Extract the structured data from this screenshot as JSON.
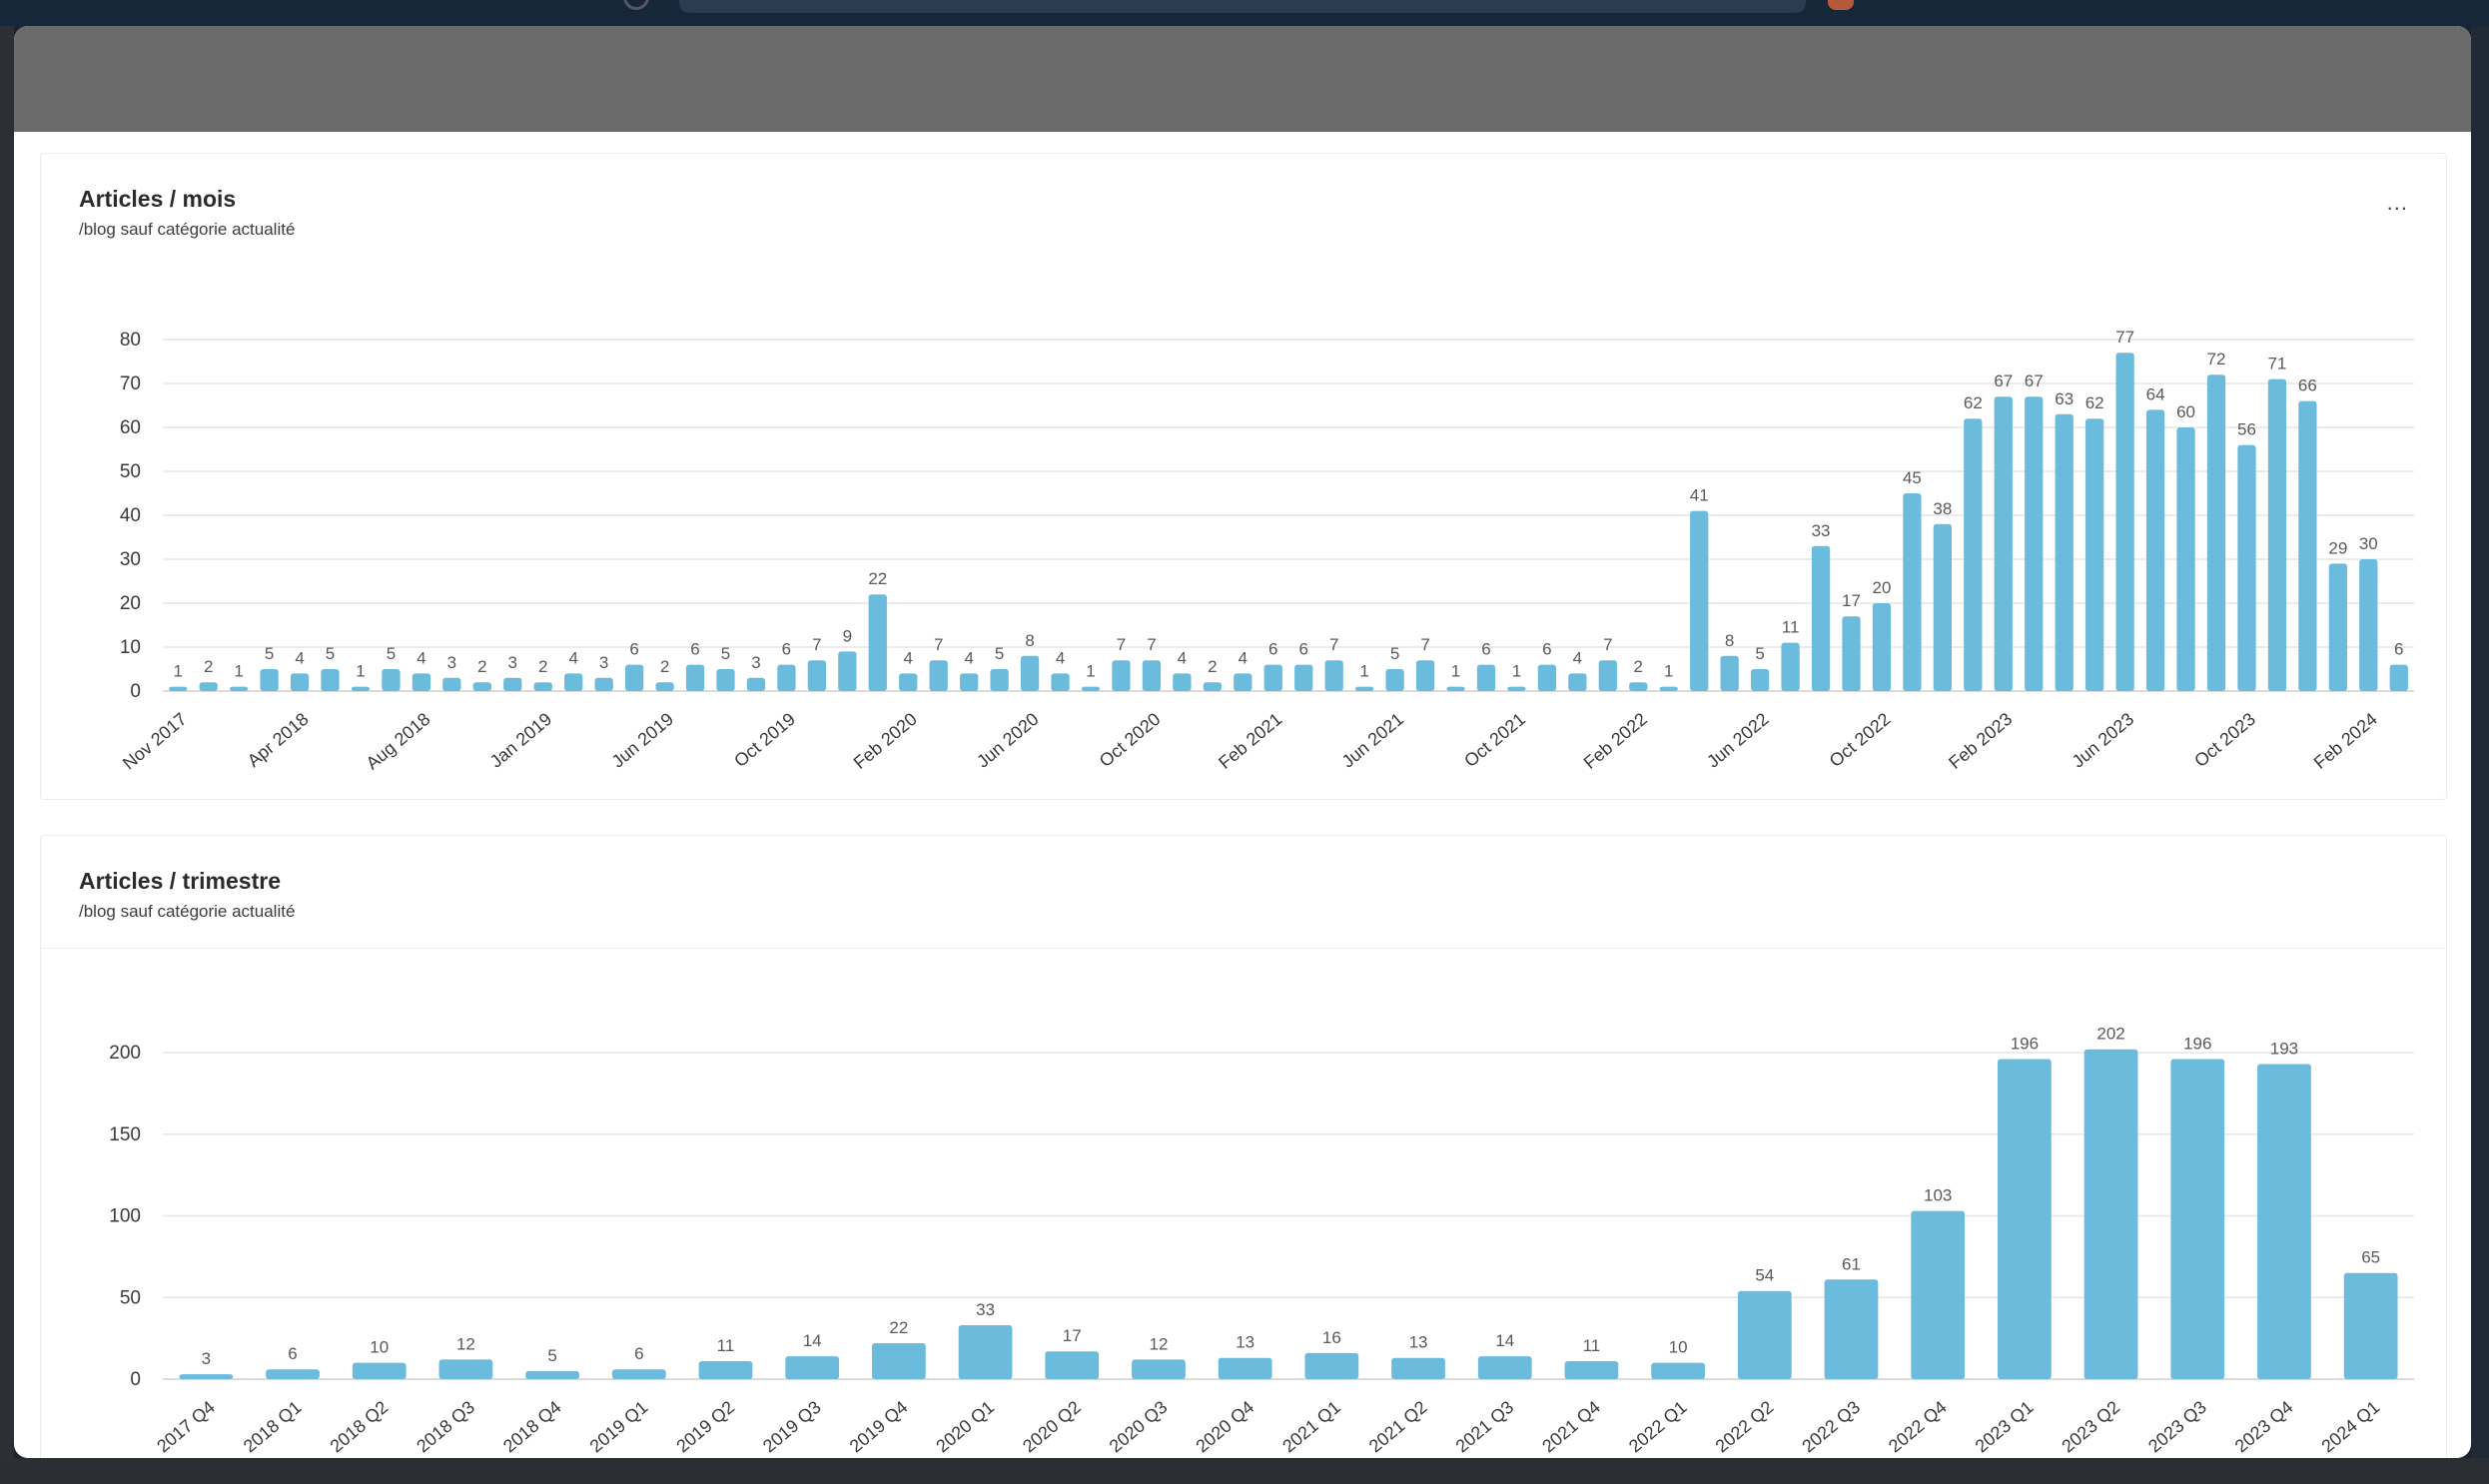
{
  "colors": {
    "bar": "#6bbbdc",
    "modal_header": "#6b6b6b",
    "title": "#2b2b2b"
  },
  "cards": [
    {
      "title": "Articles / mois",
      "subtitle": "/blog sauf catégorie actualité",
      "more_label": "...",
      "more_icon": "ellipsis-icon"
    },
    {
      "title": "Articles / trimestre",
      "subtitle": "/blog sauf catégorie actualité"
    }
  ],
  "chart_data": [
    {
      "type": "bar",
      "title": "Articles / mois",
      "subtitle": "/blog sauf catégorie actualité",
      "ylim": [
        0,
        80
      ],
      "yticks": [
        0,
        10,
        20,
        30,
        40,
        50,
        60,
        70,
        80
      ],
      "grid": true,
      "x_tick_labels": [
        {
          "index": 0,
          "label": "Nov 2017"
        },
        {
          "index": 4,
          "label": "Apr 2018"
        },
        {
          "index": 8,
          "label": "Aug 2018"
        },
        {
          "index": 12,
          "label": "Jan 2019"
        },
        {
          "index": 16,
          "label": "Jun 2019"
        },
        {
          "index": 20,
          "label": "Oct 2019"
        },
        {
          "index": 24,
          "label": "Feb 2020"
        },
        {
          "index": 28,
          "label": "Jun 2020"
        },
        {
          "index": 32,
          "label": "Oct 2020"
        },
        {
          "index": 36,
          "label": "Feb 2021"
        },
        {
          "index": 40,
          "label": "Jun 2021"
        },
        {
          "index": 44,
          "label": "Oct 2021"
        },
        {
          "index": 48,
          "label": "Feb 2022"
        },
        {
          "index": 52,
          "label": "Jun 2022"
        },
        {
          "index": 56,
          "label": "Oct 2022"
        },
        {
          "index": 60,
          "label": "Feb 2023"
        },
        {
          "index": 64,
          "label": "Jun 2023"
        },
        {
          "index": 68,
          "label": "Oct 2023"
        },
        {
          "index": 72,
          "label": "Feb 2024"
        }
      ],
      "values": [
        1,
        2,
        1,
        5,
        4,
        5,
        1,
        5,
        4,
        3,
        2,
        3,
        2,
        4,
        3,
        6,
        2,
        6,
        5,
        3,
        6,
        7,
        9,
        22,
        4,
        7,
        4,
        5,
        8,
        4,
        1,
        7,
        7,
        4,
        2,
        4,
        6,
        6,
        7,
        1,
        5,
        7,
        1,
        6,
        1,
        6,
        4,
        7,
        2,
        1,
        41,
        8,
        5,
        11,
        33,
        17,
        20,
        45,
        38,
        62,
        67,
        67,
        63,
        62,
        77,
        64,
        60,
        72,
        56,
        71,
        66,
        29,
        30,
        6
      ]
    },
    {
      "type": "bar",
      "title": "Articles / trimestre",
      "subtitle": "/blog sauf catégorie actualité",
      "ylim": [
        0,
        200
      ],
      "yticks": [
        0,
        50,
        100,
        150,
        200
      ],
      "grid": true,
      "categories": [
        "2017 Q4",
        "2018 Q1",
        "2018 Q2",
        "2018 Q3",
        "2018 Q4",
        "2019 Q1",
        "2019 Q2",
        "2019 Q3",
        "2019 Q4",
        "2020 Q1",
        "2020 Q2",
        "2020 Q3",
        "2020 Q4",
        "2021 Q1",
        "2021 Q2",
        "2021 Q3",
        "2021 Q4",
        "2022 Q1",
        "2022 Q2",
        "2022 Q3",
        "2022 Q4",
        "2023 Q1",
        "2023 Q2",
        "2023 Q3",
        "2023 Q4",
        "2024 Q1"
      ],
      "values": [
        3,
        6,
        10,
        12,
        5,
        6,
        11,
        14,
        22,
        33,
        17,
        12,
        13,
        16,
        13,
        14,
        11,
        10,
        54,
        61,
        103,
        196,
        202,
        196,
        193,
        65
      ]
    }
  ]
}
